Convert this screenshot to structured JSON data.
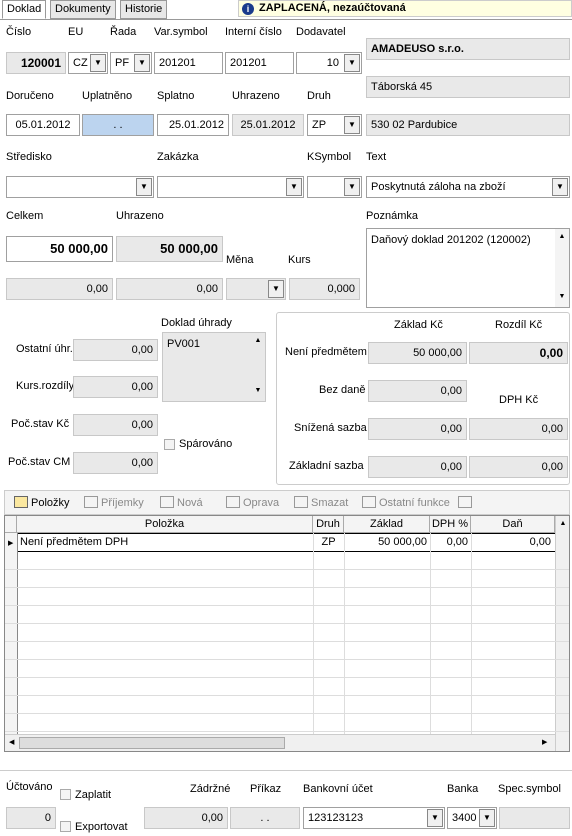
{
  "tabs": [
    "Doklad",
    "Dokumenty",
    "Historie"
  ],
  "status": "ZAPLACENÁ, nezaúčtovaná",
  "labels": {
    "cislo": "Číslo",
    "eu": "EU",
    "rada": "Řada",
    "varsym": "Var.symbol",
    "intcislo": "Interní číslo",
    "dodavatel": "Dodavatel",
    "doruceno": "Doručeno",
    "uplatneno": "Uplatněno",
    "splatno": "Splatno",
    "uhrazeno": "Uhrazeno",
    "druh": "Druh",
    "stredisko": "Středisko",
    "zakazka": "Zakázka",
    "ksymbol": "KSymbol",
    "text": "Text",
    "celkem": "Celkem",
    "uhrazeno2": "Uhrazeno",
    "mena": "Měna",
    "kurs": "Kurs",
    "poznamka": "Poznámka",
    "doklad_uhrady": "Doklad úhrady",
    "ostatni_uhr": "Ostatní úhr.",
    "kurs_rozdily": "Kurs.rozdíly",
    "poc_stav_kc": "Poč.stav Kč",
    "poc_stav_cm": "Poč.stav CM",
    "sparovano": "Spárováno",
    "zaklad_kc": "Základ Kč",
    "rozdil_kc": "Rozdíl Kč",
    "neni_predmetem": "Není předmětem",
    "bez_dane": "Bez daně",
    "dph_kc": "DPH Kč",
    "snizena": "Snížená sazba",
    "zakladni": "Základní sazba",
    "uctovano": "Účtováno",
    "zaplatit": "Zaplatit",
    "exportovat": "Exportovat",
    "zadrzne": "Zádržné",
    "prikaz": "Příkaz",
    "bankovni_ucet": "Bankovní účet",
    "banka": "Banka",
    "spec_symbol": "Spec.symbol"
  },
  "values": {
    "cislo": "120001",
    "eu": "CZ",
    "rada": "PF",
    "varsym": "201201",
    "intcislo": "201201",
    "dodavatel": "10",
    "firma": "AMADEUSO s.r.o.",
    "ulice": "Táborská 45",
    "mesto": "530 02 Pardubice",
    "doruceno": "05.01.2012",
    "uplatneno": ". .",
    "splatno": "25.01.2012",
    "uhrazeno": "25.01.2012",
    "druh": "ZP",
    "text": "Poskytnutá záloha na zboží",
    "celkem": "50 000,00",
    "uhrazeno_celkem": "50 000,00",
    "celkem2": "0,00",
    "uhrazeno2": "0,00",
    "kurs": "0,000",
    "poznamka": "Daňový doklad 201202 (120002)",
    "doklad_uhrady": "PV001",
    "ostatni_uhr": "0,00",
    "kurs_rozdily": "0,00",
    "poc_stav_kc": "0,00",
    "poc_stav_cm": "0,00",
    "neni_zaklad": "50 000,00",
    "neni_rozdil": "0,00",
    "bez_dane": "0,00",
    "snizena_zaklad": "0,00",
    "snizena_dph": "0,00",
    "zakladni_zaklad": "0,00",
    "zakladni_dph": "0,00",
    "uctovano": "0",
    "zadrzne": "0,00",
    "prikaz": ". .",
    "bankovni_ucet": "123123123",
    "banka": "3400"
  },
  "toolbar": [
    "Položky",
    "Příjemky",
    "Nová",
    "Oprava",
    "Smazat",
    "Ostatní funkce"
  ],
  "grid": {
    "headers": [
      "Položka",
      "Druh",
      "Základ",
      "DPH %",
      "Daň"
    ],
    "rows": [
      [
        "Není předmětem DPH",
        "ZP",
        "50 000,00",
        "0,00",
        "0,00"
      ]
    ]
  },
  "colors": {
    "accent": "#bcd4ef",
    "readonly": "#e9e9e9"
  }
}
